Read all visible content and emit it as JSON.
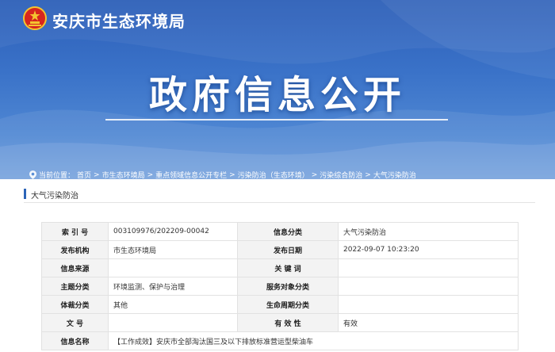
{
  "header": {
    "site_name": "安庆市生态环境局",
    "banner_title": "政府信息公开"
  },
  "breadcrumb": {
    "prefix": "当前位置：",
    "items": [
      "首页",
      "市生态环境局",
      "重点领域信息公开专栏",
      "污染防治（生态环境）",
      "污染综合防治",
      "大气污染防治"
    ],
    "separators": [
      ">",
      ">",
      ">",
      ">",
      ">"
    ]
  },
  "column": {
    "title": "大气污染防治"
  },
  "info_table": {
    "rows": [
      [
        {
          "label": "索 引 号",
          "value": "003109976/202209-00042"
        },
        {
          "label": "信息分类",
          "value": "大气污染防治"
        }
      ],
      [
        {
          "label": "发布机构",
          "value": "市生态环境局"
        },
        {
          "label": "发布日期",
          "value": "2022-09-07 10:23:20"
        }
      ],
      [
        {
          "label": "信息来源",
          "value": ""
        },
        {
          "label": "关 键 词",
          "value": ""
        }
      ],
      [
        {
          "label": "主题分类",
          "value": "环境监测、保护与治理"
        },
        {
          "label": "服务对象分类",
          "value": ""
        }
      ],
      [
        {
          "label": "体裁分类",
          "value": "其他"
        },
        {
          "label": "生命周期分类",
          "value": ""
        }
      ],
      [
        {
          "label": "文 号",
          "value": ""
        },
        {
          "label": "有 效 性",
          "value": "有效"
        }
      ]
    ],
    "name_row": {
      "label": "信息名称",
      "value": "【工作成效】安庆市全部淘汰国三及以下排放标准营运型柴油车"
    }
  },
  "colors": {
    "banner_top": "#2d5fb8",
    "banner_bottom": "#6a9ada",
    "accent": "#2c64b8",
    "label_bg": "#f3f3f3",
    "emblem_red": "#d7261e",
    "emblem_gold": "#f4c430"
  },
  "icons": {
    "emblem": "national-emblem-icon",
    "breadcrumb": "location-pin-icon"
  }
}
